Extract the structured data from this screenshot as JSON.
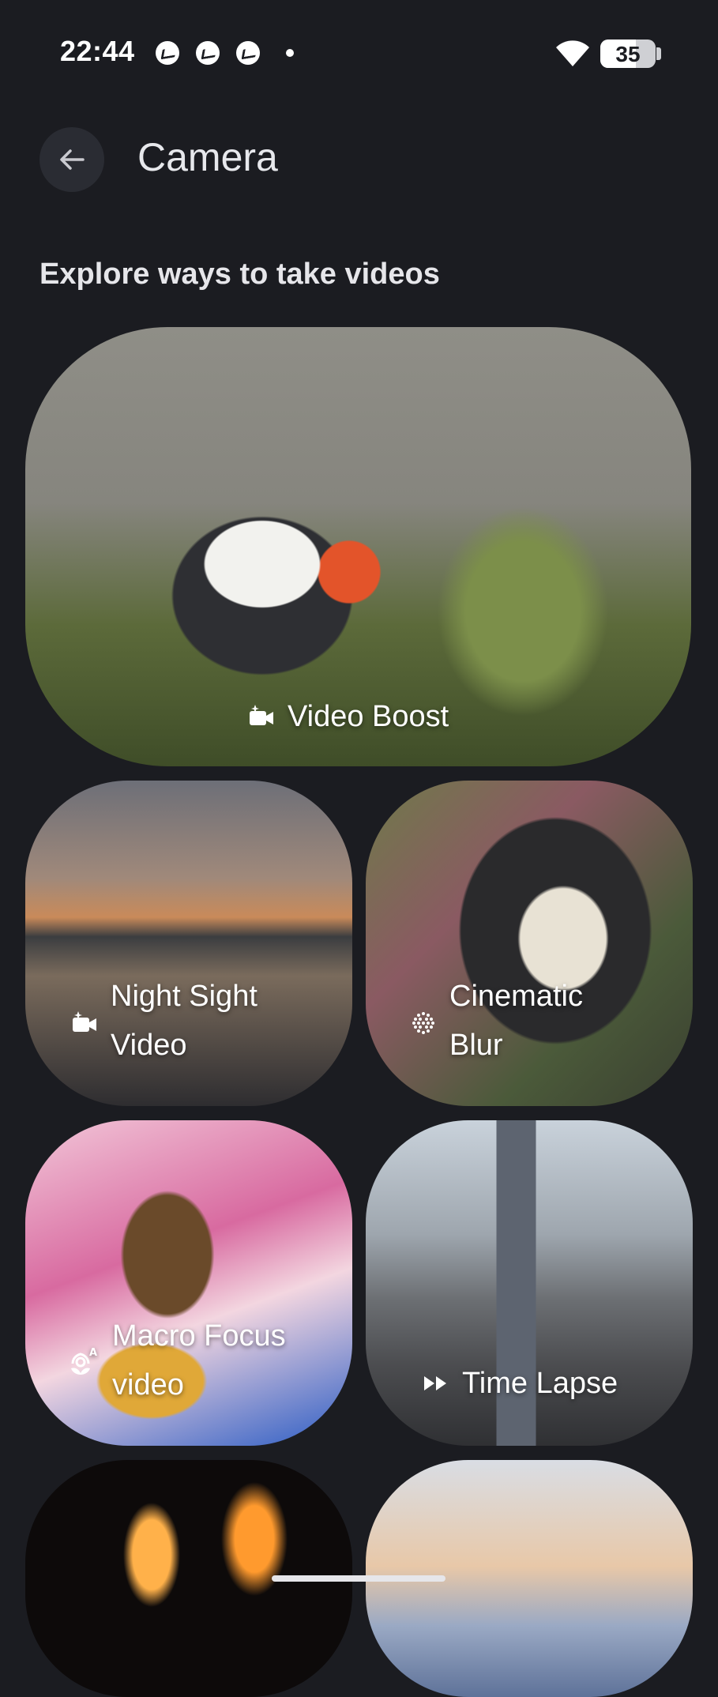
{
  "status_bar": {
    "time": "22:44",
    "notification_icons": [
      "messenger-icon",
      "messenger-icon",
      "messenger-icon"
    ],
    "battery": "35"
  },
  "app_bar": {
    "title": "Camera",
    "back_icon": "arrow-left-icon"
  },
  "section": {
    "title": "Explore ways to take videos"
  },
  "cards": [
    {
      "label": "Video Boost",
      "icon": "video-camera-sparkle-icon"
    },
    {
      "label_line1": "Night Sight",
      "label_line2": "Video",
      "icon": "video-camera-sparkle-icon"
    },
    {
      "label_line1": "Cinematic",
      "label_line2": "Blur",
      "icon": "dotted-circle-icon"
    },
    {
      "label_line1": "Macro Focus",
      "label_line2": "video",
      "icon": "flower-auto-icon"
    },
    {
      "label": "Time Lapse",
      "icon": "fast-forward-icon"
    }
  ],
  "colors": {
    "background": "#1b1c21",
    "text": "#e6e6ea",
    "back_button_bg": "#2a2c33"
  }
}
